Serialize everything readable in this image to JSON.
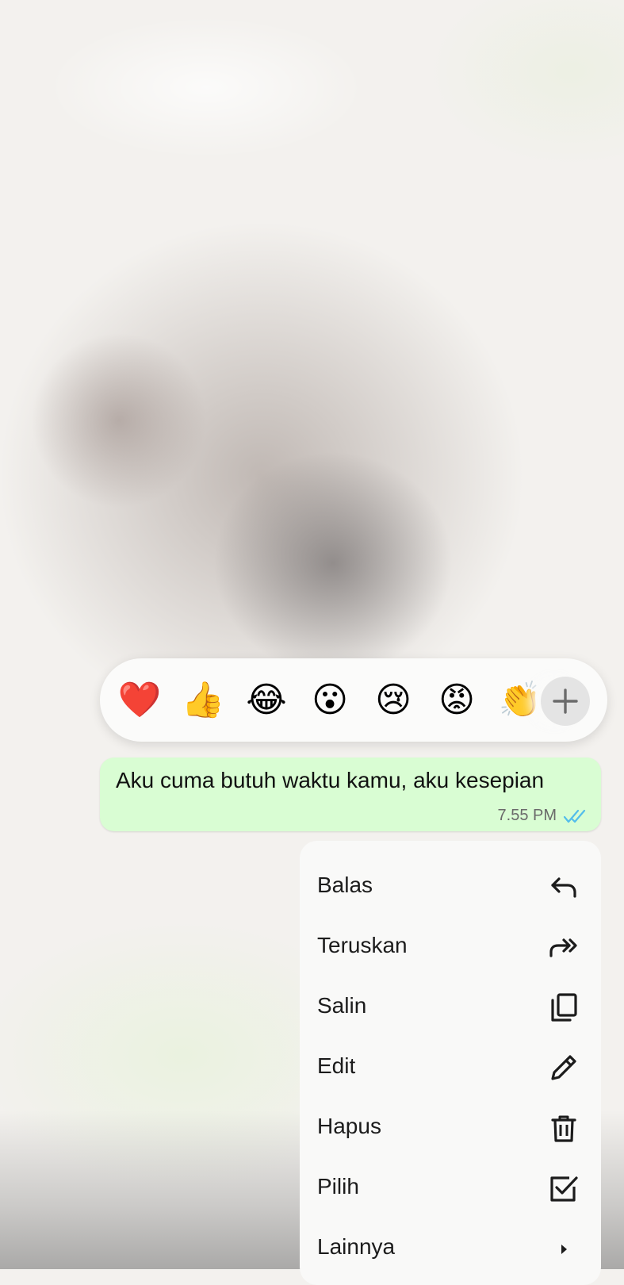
{
  "reactions": {
    "emojis": [
      {
        "name": "heart",
        "char": "❤️"
      },
      {
        "name": "thumbs-up",
        "char": "👍"
      },
      {
        "name": "tears-of-joy",
        "char": "😂"
      },
      {
        "name": "surprised",
        "char": "😮"
      },
      {
        "name": "crying",
        "char": "😢"
      },
      {
        "name": "angry",
        "char": "😡"
      },
      {
        "name": "clapping",
        "char": "👏"
      }
    ],
    "more_icon": "plus-icon"
  },
  "message": {
    "text": "Aku cuma butuh waktu kamu, aku kesepian",
    "time": "7.55 PM",
    "status_icon": "double-check-icon",
    "status_color": "#53bdeb",
    "bubble_color": "#d9fdd3"
  },
  "menu": {
    "items": [
      {
        "label": "Balas",
        "icon": "reply-icon"
      },
      {
        "label": "Teruskan",
        "icon": "forward-icon"
      },
      {
        "label": "Salin",
        "icon": "copy-icon"
      },
      {
        "label": "Edit",
        "icon": "pencil-icon"
      },
      {
        "label": "Hapus",
        "icon": "trash-icon"
      },
      {
        "label": "Pilih",
        "icon": "checkbox-icon"
      },
      {
        "label": "Lainnya",
        "icon": "chevron-right-icon"
      }
    ]
  }
}
